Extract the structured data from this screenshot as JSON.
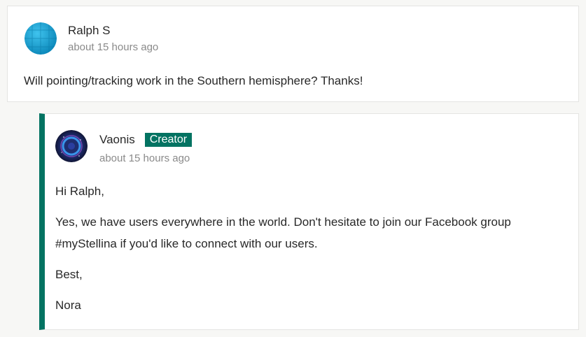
{
  "comment": {
    "author": "Ralph S",
    "timestamp": "about 15 hours ago",
    "text": "Will pointing/tracking work in the Southern hemisphere? Thanks!"
  },
  "reply": {
    "author": "Vaonis",
    "badge": "Creator",
    "timestamp": "about 15 hours ago",
    "paragraphs": [
      "Hi Ralph,",
      "Yes, we have users everywhere in the world. Don't hesitate to join our Facebook group #myStellina if you'd like to connect with our users.",
      "Best,",
      "Nora"
    ]
  },
  "colors": {
    "accent": "#037362",
    "text": "#282828",
    "muted": "#8a8a8a",
    "background": "#f7f7f5"
  },
  "icons": {
    "commenter_avatar": "user-avatar-icon",
    "creator_avatar": "creator-avatar-icon"
  }
}
